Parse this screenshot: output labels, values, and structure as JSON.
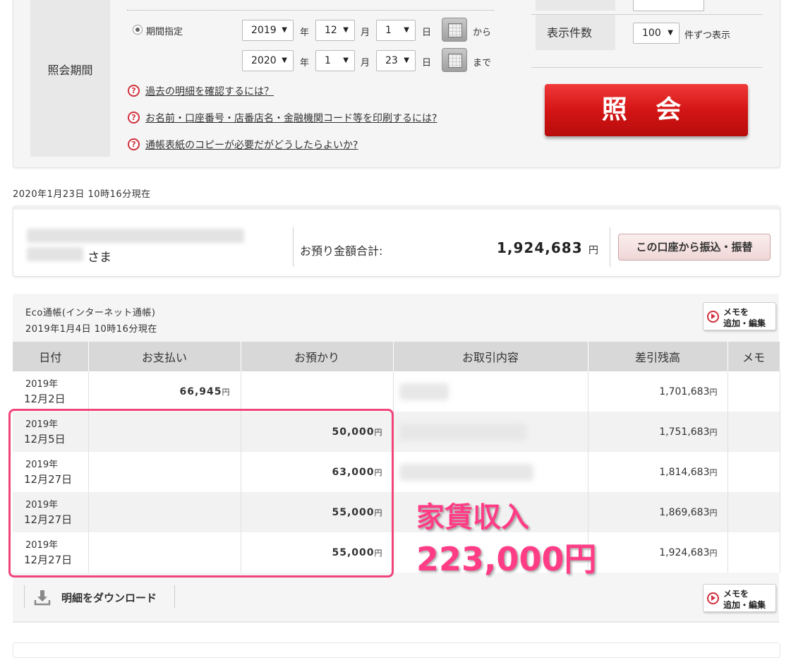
{
  "search": {
    "period_label": "照会期間",
    "period_option": "期間指定",
    "from": {
      "year": "2019",
      "month": "12",
      "day": "1",
      "suffix": "から"
    },
    "to": {
      "year": "2020",
      "month": "1",
      "day": "23",
      "suffix": "まで"
    },
    "unit_year": "年",
    "unit_month": "月",
    "unit_day": "日",
    "help_links": [
      "過去の明細を確認するには？",
      "お名前・口座番号・店番店名・金融機関コード等を印刷するには?",
      "通帳表紙のコピーが必要だがどうしたらよいか?"
    ],
    "count_label": "表示件数",
    "count_value": "100",
    "count_suffix": "件ずつ表示",
    "submit_label": "照 会"
  },
  "timestamp": "2020年1月23日 10時16分現在",
  "account": {
    "name_suffix": "さま",
    "balance_label": "お預り金額合計:",
    "balance_value": "1,924,683",
    "balance_unit": "円",
    "transfer_button": "この口座から振込・振替"
  },
  "passbook": {
    "title": "Eco通帳(インターネット通帳)",
    "as_of": "2019年1月4日 10時16分現在",
    "memo_button": {
      "line1": "メモを",
      "line2": "追加・編集"
    },
    "columns": [
      "日付",
      "お支払い",
      "お預かり",
      "お取引内容",
      "差引残高",
      "メモ"
    ],
    "yen": "円",
    "rows": [
      {
        "year": "2019年",
        "md": "12月2日",
        "payment": "66,945",
        "deposit": "",
        "balance": "1,701,683"
      },
      {
        "year": "2019年",
        "md": "12月5日",
        "payment": "",
        "deposit": "50,000",
        "balance": "1,751,683"
      },
      {
        "year": "2019年",
        "md": "12月27日",
        "payment": "",
        "deposit": "63,000",
        "balance": "1,814,683"
      },
      {
        "year": "2019年",
        "md": "12月27日",
        "payment": "",
        "deposit": "55,000",
        "balance": "1,869,683"
      },
      {
        "year": "2019年",
        "md": "12月27日",
        "payment": "",
        "deposit": "55,000",
        "balance": "1,924,683"
      }
    ],
    "download_label": "明細をダウンロード"
  },
  "annotation": {
    "line1": "家賃収入",
    "line2": "223,000円",
    "color": "#ff3d86"
  }
}
